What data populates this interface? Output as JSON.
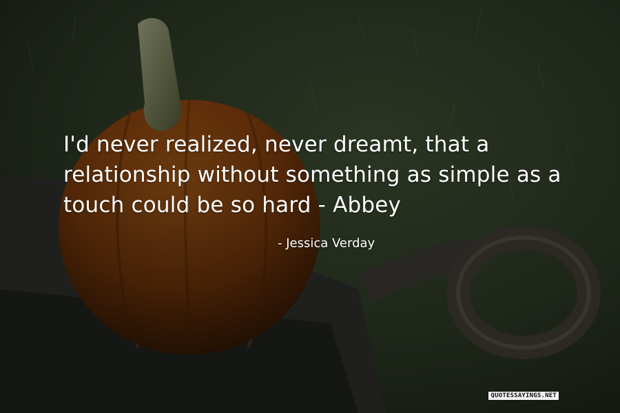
{
  "quote": {
    "lines": [
      "I'd never realized, never dreamt, that a",
      "relationship without something as simple as a",
      "touch could be so hard - Abbey"
    ],
    "author": "- Jessica Verday"
  },
  "watermark": "QUOTESSAYINGS.NET",
  "colors": {
    "background_grass": "#2f3d28",
    "pumpkin": "#b05a12",
    "text": "#ffffff"
  }
}
